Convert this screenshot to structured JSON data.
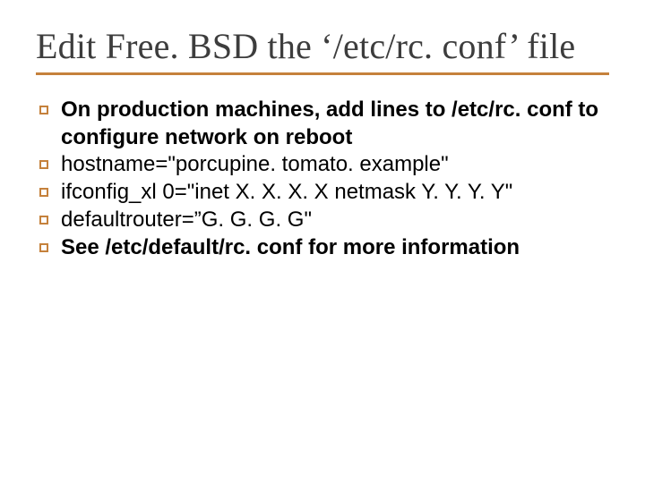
{
  "slide": {
    "title": "Edit Free. BSD the ‘/etc/rc. conf’ file",
    "items": [
      {
        "text": "On production machines, add lines to /etc/rc. conf to configure network on reboot",
        "bold": true
      },
      {
        "text": "hostname=\"porcupine. tomato. example\"",
        "bold": false
      },
      {
        "text": "ifconfig_xl 0=\"inet X. X. X. X netmask Y. Y. Y. Y\"",
        "bold": false
      },
      {
        "text": "defaultrouter=”G. G. G. G\"",
        "bold": false
      },
      {
        "text": "See /etc/default/rc. conf for more information",
        "bold": true
      }
    ]
  }
}
